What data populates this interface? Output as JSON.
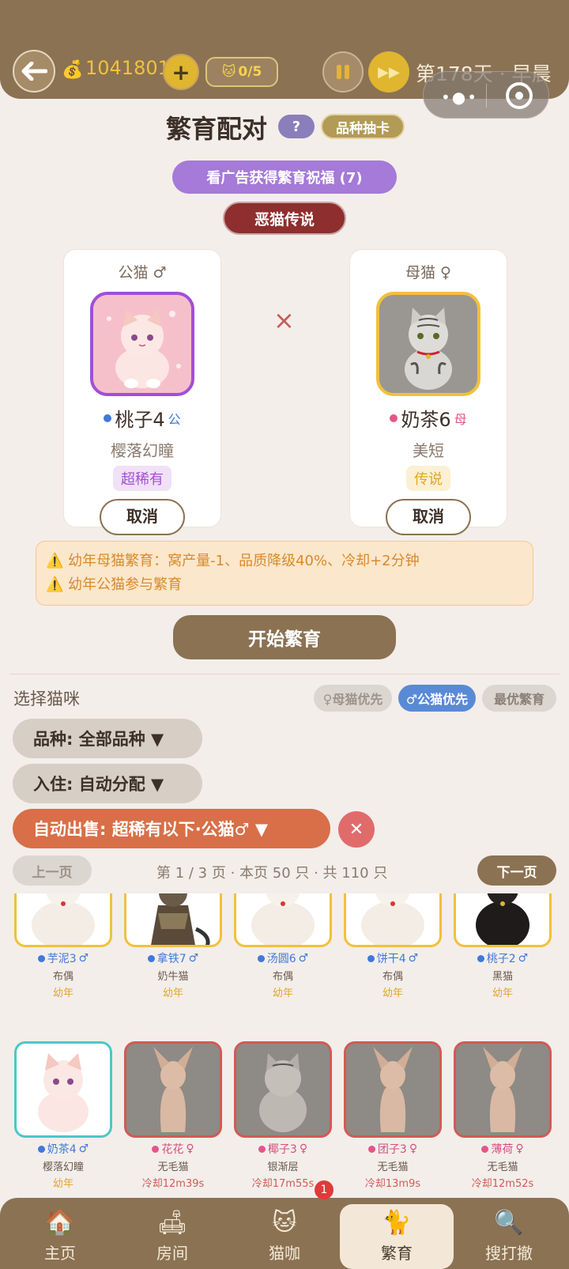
{
  "header": {
    "money": "1041801",
    "money_icon": "💰",
    "plus_label": "+",
    "cat_count": "0/5",
    "cat_icon": "🐱",
    "day_label": "第178天 · 早晨"
  },
  "page": {
    "title": "繁育配对",
    "help_label": "?",
    "gacha_label": "品种抽卡",
    "ad_label": "看广告获得繁育祝福 (7)",
    "legend_label": "恶猫传说"
  },
  "pair": {
    "cross": "×",
    "male": {
      "role": "公猫 ♂",
      "name": "桃子4",
      "sex": "公",
      "breed": "樱落幻瞳",
      "rarity": "超稀有",
      "cancel": "取消"
    },
    "female": {
      "role": "母猫 ♀",
      "name": "奶茶6",
      "sex": "母",
      "breed": "美短",
      "rarity": "传说",
      "cancel": "取消"
    }
  },
  "warnings": [
    "⚠️ 幼年母猫繁育：窝产量-1、品质降级40%、冷却+2分钟",
    "⚠️ 幼年公猫参与繁育"
  ],
  "start_label": "开始繁育",
  "select": {
    "title": "选择猫咪",
    "prio_female": "♀母猫优先",
    "prio_male": "♂公猫优先",
    "prio_best": "最优繁育",
    "filter_breed": "品种: 全部品种 ▼",
    "filter_housing": "入住: 自动分配 ▼",
    "filter_sell": "自动出售: 超稀有以下·公猫♂ ▼",
    "clear": "✕"
  },
  "pager": {
    "prev": "上一页",
    "info": "第 1 / 3 页 · 本页 50 只 · 共 110 只",
    "next": "下一页"
  },
  "cats_row1": [
    {
      "name": "芋泥3",
      "sex": "♂",
      "breed": "布偶",
      "status": "幼年"
    },
    {
      "name": "拿铁7",
      "sex": "♂",
      "breed": "奶牛猫",
      "status": "幼年"
    },
    {
      "name": "汤圆6",
      "sex": "♂",
      "breed": "布偶",
      "status": "幼年"
    },
    {
      "name": "饼干4",
      "sex": "♂",
      "breed": "布偶",
      "status": "幼年"
    },
    {
      "name": "桃子2",
      "sex": "♂",
      "breed": "黑猫",
      "status": "幼年"
    }
  ],
  "cats_row2": [
    {
      "name": "奶茶4",
      "sex": "♂",
      "breed": "樱落幻瞳",
      "status": "幼年"
    },
    {
      "name": "花花",
      "sex": "♀",
      "breed": "无毛猫",
      "status": "冷却12m39s"
    },
    {
      "name": "椰子3",
      "sex": "♀",
      "breed": "银渐层",
      "status": "冷却17m55s"
    },
    {
      "name": "团子3",
      "sex": "♀",
      "breed": "无毛猫",
      "status": "冷却13m9s"
    },
    {
      "name": "薄荷",
      "sex": "♀",
      "breed": "无毛猫",
      "status": "冷却12m52s"
    }
  ],
  "nav": [
    {
      "label": "主页",
      "icon": "🏠"
    },
    {
      "label": "房间",
      "icon": "🛋"
    },
    {
      "label": "猫咖",
      "icon": "🐱"
    },
    {
      "label": "繁育",
      "icon": "🐈"
    },
    {
      "label": "搜打撤",
      "icon": "🔍"
    }
  ],
  "nav_badge": "1"
}
